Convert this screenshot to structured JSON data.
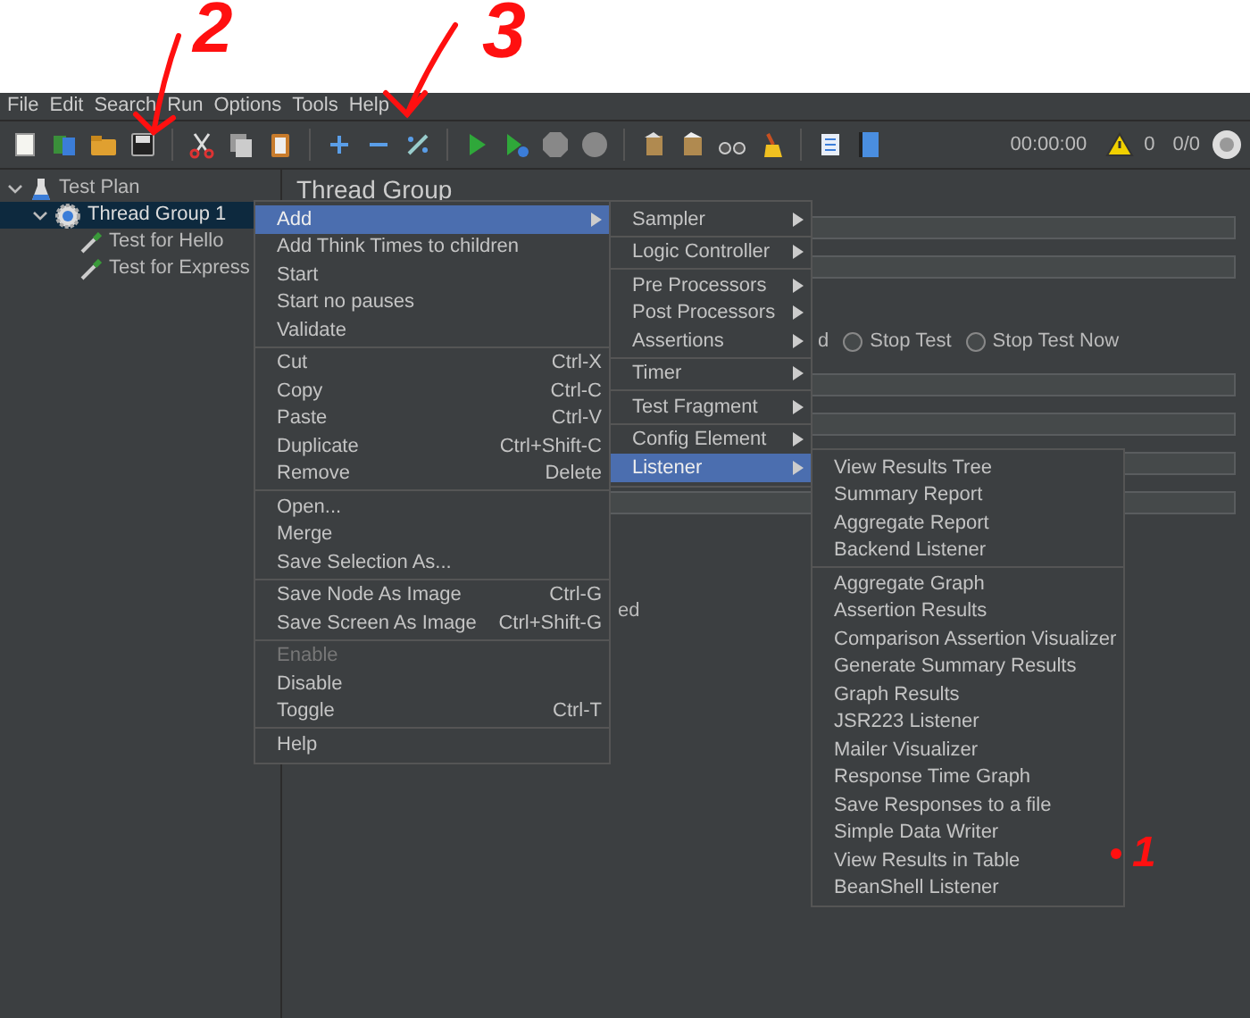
{
  "annotations": [
    {
      "text": "2"
    },
    {
      "text": "3"
    },
    {
      "text": "1"
    }
  ],
  "menubar": [
    "File",
    "Edit",
    "Search",
    "Run",
    "Options",
    "Tools",
    "Help"
  ],
  "status": {
    "timer": "00:00:00",
    "warnings": "0",
    "threads": "0/0"
  },
  "tree": [
    {
      "label": "Test Plan",
      "kind": "plan",
      "expanded": true,
      "selected": false,
      "children": [
        {
          "label": "Thread Group 1",
          "kind": "group",
          "expanded": true,
          "selected": true,
          "children": [
            {
              "label": "Test for Hello",
              "kind": "sampler",
              "selected": false
            },
            {
              "label": "Test for Express",
              "kind": "sampler",
              "selected": false
            }
          ]
        }
      ]
    }
  ],
  "panel": {
    "title": "Thread Group",
    "radio_fragment": "d",
    "radios": [
      {
        "label": "Stop Test",
        "selected": false
      },
      {
        "label": "Stop Test Now",
        "selected": false
      }
    ],
    "fragment": "ed"
  },
  "context_menu": {
    "groups": [
      [
        {
          "label": "Add",
          "has_submenu": true,
          "selected": true,
          "disabled": false,
          "submenu": {
            "groups": [
              [
                {
                  "label": "Sampler",
                  "has_submenu": true,
                  "selected": false
                }
              ],
              [
                {
                  "label": "Logic Controller",
                  "has_submenu": true,
                  "selected": false
                }
              ],
              [
                {
                  "label": "Pre Processors",
                  "has_submenu": true,
                  "selected": false
                },
                {
                  "label": "Post Processors",
                  "has_submenu": true,
                  "selected": false
                },
                {
                  "label": "Assertions",
                  "has_submenu": true,
                  "selected": false
                }
              ],
              [
                {
                  "label": "Timer",
                  "has_submenu": true,
                  "selected": false
                }
              ],
              [
                {
                  "label": "Test Fragment",
                  "has_submenu": true,
                  "selected": false
                }
              ],
              [
                {
                  "label": "Config Element",
                  "has_submenu": true,
                  "selected": false
                },
                {
                  "label": "Listener",
                  "has_submenu": true,
                  "selected": true,
                  "submenu": {
                    "groups": [
                      [
                        {
                          "label": "View Results Tree",
                          "selected": false
                        },
                        {
                          "label": "Summary Report",
                          "selected": false
                        },
                        {
                          "label": "Aggregate Report",
                          "selected": false
                        },
                        {
                          "label": "Backend Listener",
                          "selected": false
                        }
                      ],
                      [
                        {
                          "label": "Aggregate Graph",
                          "selected": false
                        },
                        {
                          "label": "Assertion Results",
                          "selected": false
                        },
                        {
                          "label": "Comparison Assertion Visualizer",
                          "selected": false
                        },
                        {
                          "label": "Generate Summary Results",
                          "selected": false
                        },
                        {
                          "label": "Graph Results",
                          "selected": false
                        },
                        {
                          "label": "JSR223 Listener",
                          "selected": false
                        },
                        {
                          "label": "Mailer Visualizer",
                          "selected": false
                        },
                        {
                          "label": "Response Time Graph",
                          "selected": false
                        },
                        {
                          "label": "Save Responses to a file",
                          "selected": false
                        },
                        {
                          "label": "Simple Data Writer",
                          "selected": false
                        },
                        {
                          "label": "View Results in Table",
                          "selected": false
                        },
                        {
                          "label": "BeanShell Listener",
                          "selected": false
                        }
                      ]
                    ]
                  }
                }
              ]
            ]
          }
        },
        {
          "label": "Add Think Times to children",
          "has_submenu": false,
          "selected": false,
          "disabled": false
        },
        {
          "label": "Start",
          "has_submenu": false,
          "selected": false,
          "disabled": false
        },
        {
          "label": "Start no pauses",
          "has_submenu": false,
          "selected": false,
          "disabled": false
        },
        {
          "label": "Validate",
          "has_submenu": false,
          "selected": false,
          "disabled": false
        }
      ],
      [
        {
          "label": "Cut",
          "shortcut": "Ctrl-X",
          "has_submenu": false,
          "selected": false,
          "disabled": false
        },
        {
          "label": "Copy",
          "shortcut": "Ctrl-C",
          "has_submenu": false,
          "selected": false,
          "disabled": false
        },
        {
          "label": "Paste",
          "shortcut": "Ctrl-V",
          "has_submenu": false,
          "selected": false,
          "disabled": false
        },
        {
          "label": "Duplicate",
          "shortcut": "Ctrl+Shift-C",
          "has_submenu": false,
          "selected": false,
          "disabled": false
        },
        {
          "label": "Remove",
          "shortcut": "Delete",
          "has_submenu": false,
          "selected": false,
          "disabled": false
        }
      ],
      [
        {
          "label": "Open...",
          "has_submenu": false,
          "selected": false,
          "disabled": false
        },
        {
          "label": "Merge",
          "has_submenu": false,
          "selected": false,
          "disabled": false
        },
        {
          "label": "Save Selection As...",
          "has_submenu": false,
          "selected": false,
          "disabled": false
        }
      ],
      [
        {
          "label": "Save Node As Image",
          "shortcut": "Ctrl-G",
          "has_submenu": false,
          "selected": false,
          "disabled": false
        },
        {
          "label": "Save Screen As Image",
          "shortcut": "Ctrl+Shift-G",
          "has_submenu": false,
          "selected": false,
          "disabled": false
        }
      ],
      [
        {
          "label": "Enable",
          "has_submenu": false,
          "selected": false,
          "disabled": true
        },
        {
          "label": "Disable",
          "has_submenu": false,
          "selected": false,
          "disabled": false
        },
        {
          "label": "Toggle",
          "shortcut": "Ctrl-T",
          "has_submenu": false,
          "selected": false,
          "disabled": false
        }
      ],
      [
        {
          "label": "Help",
          "has_submenu": false,
          "selected": false,
          "disabled": false
        }
      ]
    ]
  }
}
